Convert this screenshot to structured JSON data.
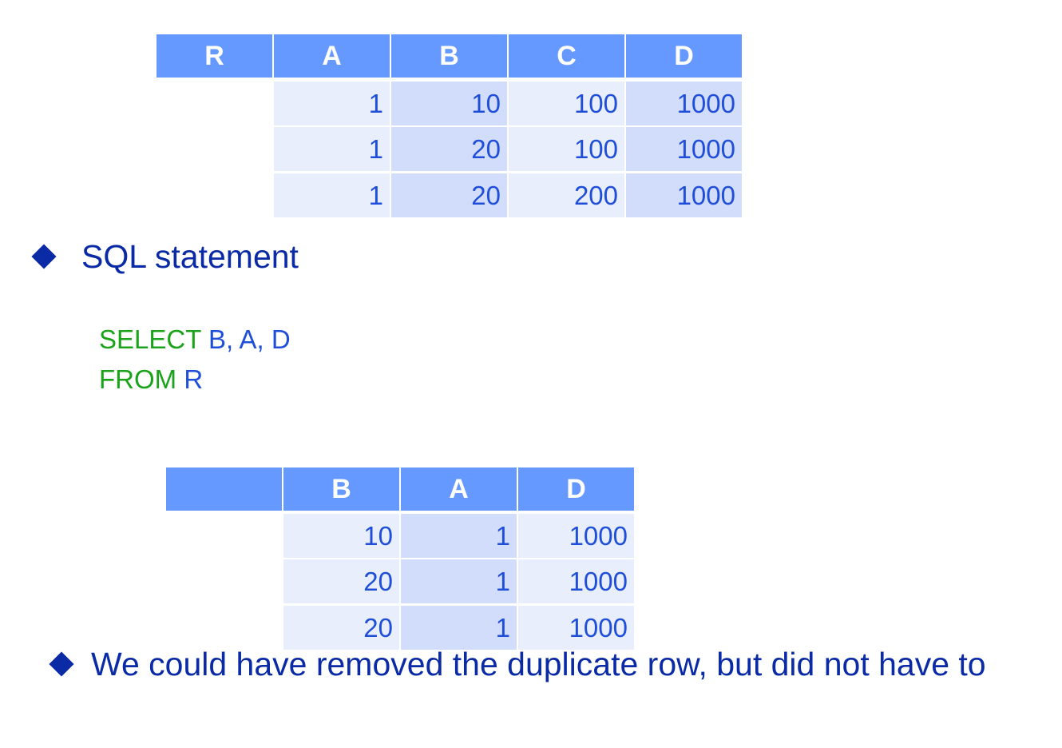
{
  "table1": {
    "headers": [
      "R",
      "A",
      "B",
      "C",
      "D"
    ],
    "rows": [
      [
        "1",
        "10",
        "100",
        "1000"
      ],
      [
        "1",
        "20",
        "100",
        "1000"
      ],
      [
        "1",
        "20",
        "200",
        "1000"
      ]
    ]
  },
  "bullet1": {
    "icon": "diamond-bullet-icon",
    "text": "SQL statement"
  },
  "sql": {
    "line1_keyword": "SELECT",
    "line1_rest": " B, A, D",
    "line2_keyword": "FROM",
    "line2_rest": " R"
  },
  "table2": {
    "headers": [
      "",
      "B",
      "A",
      "D"
    ],
    "rows": [
      [
        "10",
        "1",
        "1000"
      ],
      [
        "20",
        "1",
        "1000"
      ],
      [
        "20",
        "1",
        "1000"
      ]
    ]
  },
  "bullet2": {
    "icon": "diamond-bullet-icon",
    "text": "We could have removed the duplicate row, but did not have to"
  },
  "colors": {
    "header_bg": "#6699ff",
    "cell_light": "#e8eefc",
    "cell_dark": "#d2dcfb",
    "bullet": "#0a2aa6",
    "keyword": "#1aa31a",
    "identifier": "#1f4fd8"
  }
}
